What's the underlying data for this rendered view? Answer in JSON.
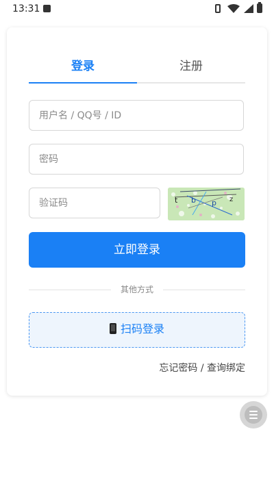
{
  "status_bar": {
    "time": "13:31"
  },
  "tabs": {
    "login_label": "登录",
    "register_label": "注册",
    "active": "login",
    "accent_color": "#1a80f5"
  },
  "form": {
    "username_placeholder": "用户名 / QQ号 / ID",
    "password_placeholder": "密码",
    "captcha_placeholder": "验证码",
    "captcha_text": "tbpz"
  },
  "login_button_label": "立即登录",
  "divider_text": "其他方式",
  "scan_login_label": "扫码登录",
  "forgot_link_label": "忘记密码 / 查询绑定",
  "icons": {
    "scan_button_icon": "phone-icon",
    "floating_button_icon": "menu-icon"
  }
}
